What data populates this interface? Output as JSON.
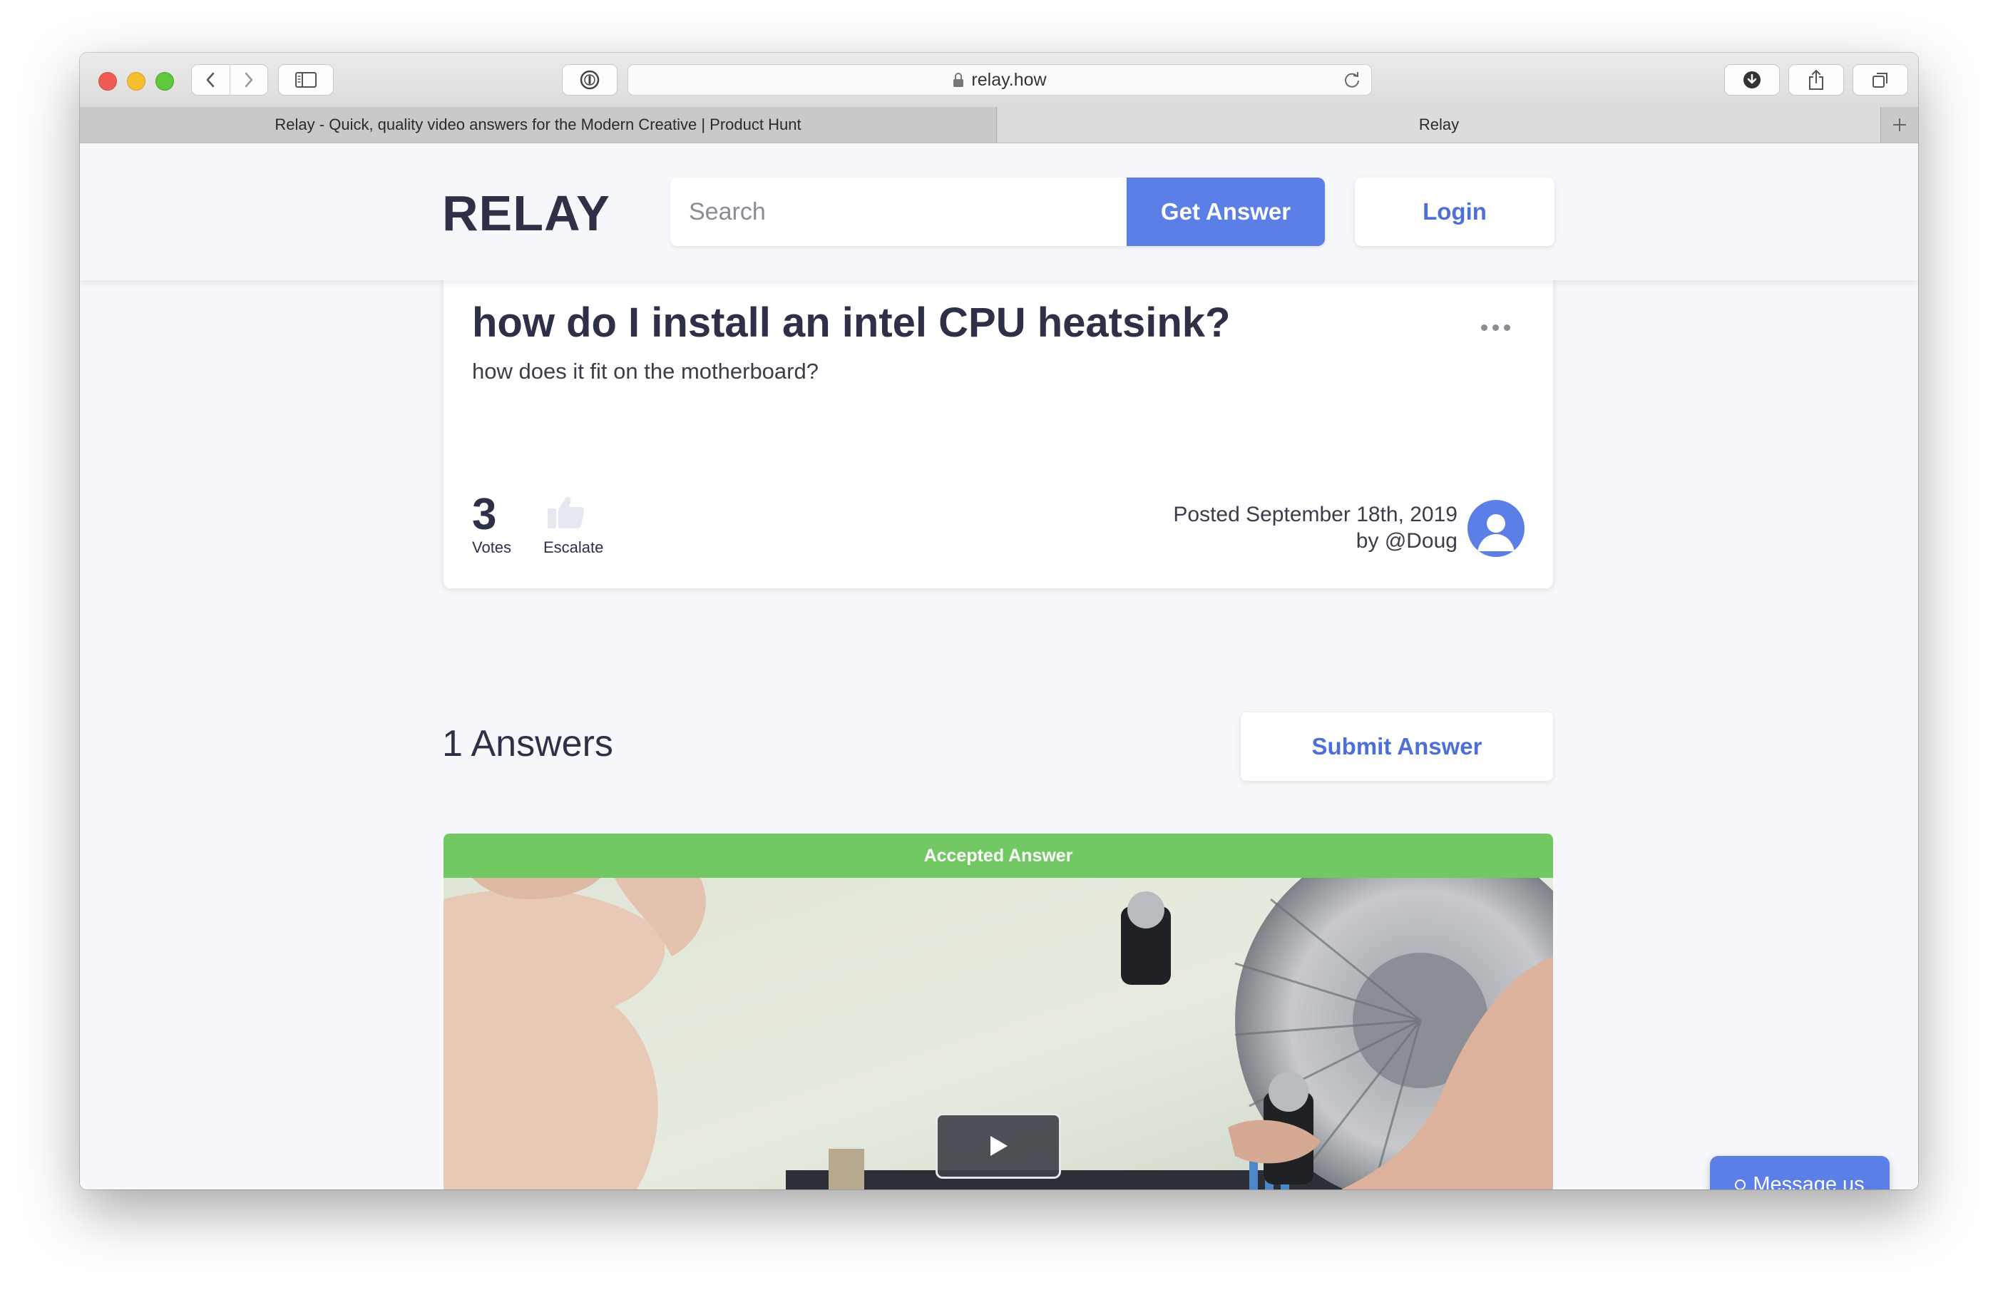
{
  "browser": {
    "url": "relay.how",
    "tabs": [
      {
        "label": "Relay - Quick, quality video answers for the Modern Creative | Product Hunt",
        "active": false
      },
      {
        "label": "Relay",
        "active": true
      }
    ]
  },
  "header": {
    "logo": "RELAY",
    "search_placeholder": "Search",
    "get_answer_label": "Get Answer",
    "login_label": "Login"
  },
  "question": {
    "title": "how do I install an intel CPU heatsink?",
    "body": "how does it fit on the motherboard?",
    "votes": "3",
    "votes_label": "Votes",
    "escalate_label": "Escalate",
    "posted": "Posted September 18th, 2019",
    "author": "by @Doug"
  },
  "answers": {
    "count_label": "1 Answers",
    "submit_label": "Submit Answer",
    "accepted_label": "Accepted Answer"
  },
  "chat": {
    "label": "Message us"
  },
  "colors": {
    "accent": "#5b7fe6",
    "accepted": "#72c964",
    "text_dark": "#2d3047"
  },
  "icons": [
    "back-icon",
    "forward-icon",
    "sidebar-icon",
    "password-icon",
    "lock-icon",
    "reload-icon",
    "download-icon",
    "share-icon",
    "tabs-icon",
    "add-tab-icon",
    "more-icon",
    "thumbs-up-icon",
    "user-icon",
    "play-icon",
    "chat-ring-icon"
  ]
}
